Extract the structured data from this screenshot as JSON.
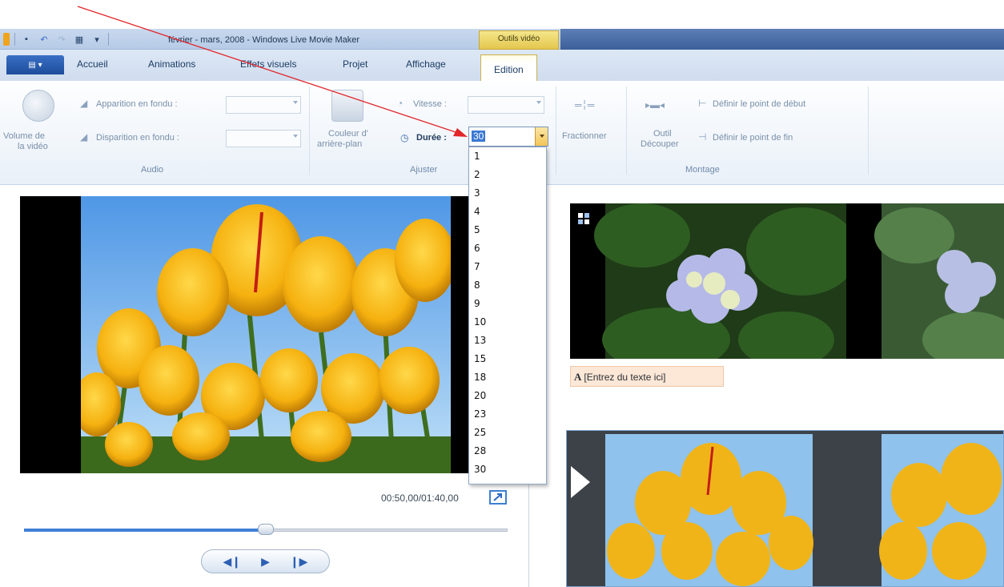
{
  "window": {
    "title": "février - mars, 2008 - Windows Live Movie Maker",
    "contextual_tab_group": "Outils vidéo"
  },
  "tabs": [
    {
      "label": "Accueil"
    },
    {
      "label": "Animations"
    },
    {
      "label": "Effets visuels"
    },
    {
      "label": "Projet"
    },
    {
      "label": "Affichage"
    },
    {
      "label": "Edition"
    }
  ],
  "ribbon": {
    "audio": {
      "group_label": "Audio",
      "volume_label_1": "Volume de",
      "volume_label_2": "la vidéo",
      "fade_in_label": "Apparition en fondu :",
      "fade_out_label": "Disparition en fondu :"
    },
    "adjust": {
      "group_label": "Ajuster",
      "background_label_1": "Couleur d'",
      "background_label_2": "arrière-plan",
      "speed_label": "Vitesse :",
      "duration_label": "Durée :",
      "duration_value": "30"
    },
    "split": {
      "label": "Fractionner"
    },
    "edit": {
      "group_label": "Montage",
      "trim_label_1": "Outil",
      "trim_label_2": "Découper",
      "set_start": "Définir le point de début",
      "set_end": "Définir le point de fin"
    }
  },
  "duration_options": [
    "1",
    "2",
    "3",
    "4",
    "5",
    "6",
    "7",
    "8",
    "9",
    "10",
    "13",
    "15",
    "18",
    "20",
    "23",
    "25",
    "28",
    "30"
  ],
  "player": {
    "timecode": "00:50,00/01:40,00",
    "progress_fraction": 0.5
  },
  "storyboard": {
    "caption_prefix": "A",
    "caption_text": "[Entrez du texte ici]"
  },
  "colors": {
    "accent": "#3b78d4",
    "annotation_arrow": "#e2262a",
    "contextual_tab": "#e4c64e"
  }
}
